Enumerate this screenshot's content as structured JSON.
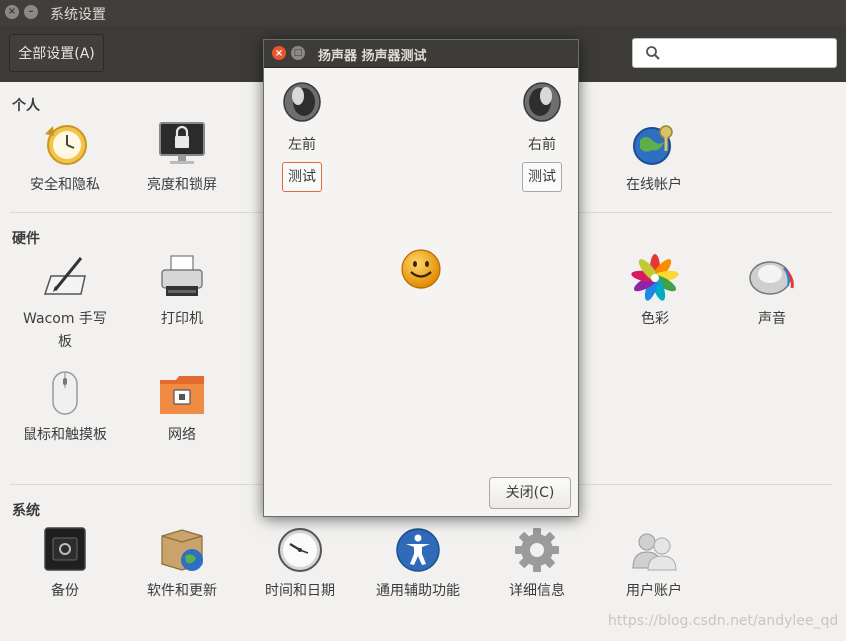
{
  "window": {
    "title": "系统设置"
  },
  "toolbar": {
    "all_settings": "全部设置(A)",
    "search_placeholder": ""
  },
  "sections": {
    "personal": {
      "title": "个人",
      "items": [
        "安全和隐私",
        "亮度和锁屏",
        "在线帐户"
      ]
    },
    "hardware": {
      "title": "硬件",
      "items": [
        "Wacom 手写",
        "板",
        "打印机",
        "色彩",
        "声音",
        "鼠标和触摸板",
        "网络"
      ]
    },
    "system": {
      "title": "系统",
      "items": [
        "备份",
        "软件和更新",
        "时间和日期",
        "通用辅助功能",
        "详细信息",
        "用户账户"
      ]
    }
  },
  "dialog": {
    "title": "扬声器 扬声器测试",
    "left_speaker": "左前",
    "right_speaker": "右前",
    "test_label": "测试",
    "close_label": "关闭(C)"
  },
  "watermark": "https://blog.csdn.net/andylee_qd",
  "colors": {
    "titlebar": "#403f3c",
    "toolbar": "#3c3b37",
    "close_accent": "#e9552b",
    "background": "#f2f1f0"
  }
}
